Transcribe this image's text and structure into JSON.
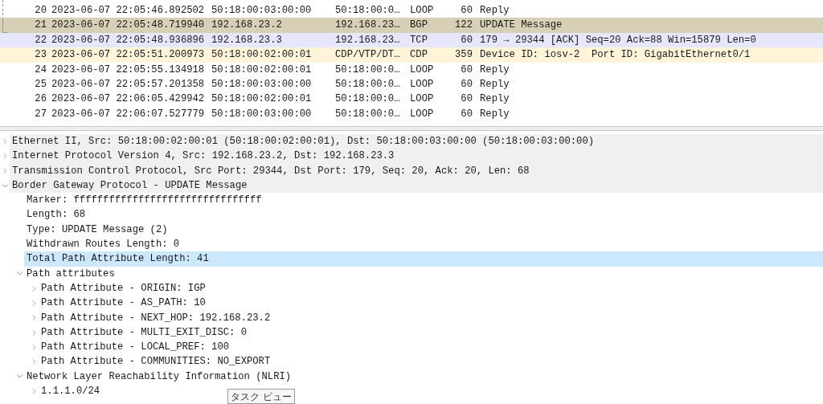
{
  "packet_list": {
    "rows": [
      {
        "cells": [
          "20",
          "2023-06-07 22:05:46.892502",
          "50:18:00:03:00:00",
          "50:18:00:0…",
          "LOOP",
          "60",
          "Reply"
        ],
        "color": "#ffffff"
      },
      {
        "cells": [
          "21",
          "2023-06-07 22:05:48.719940",
          "192.168.23.2",
          "192.168.23…",
          "BGP",
          "122",
          "UPDATE Message"
        ],
        "color": "#d7d0b6"
      },
      {
        "cells": [
          "22",
          "2023-06-07 22:05:48.936896",
          "192.168.23.3",
          "192.168.23…",
          "TCP",
          "60",
          "179 → 29344 [ACK] Seq=20 Ack=88 Win=15879 Len=0"
        ],
        "color": "#e6e6fc"
      },
      {
        "cells": [
          "23",
          "2023-06-07 22:05:51.200973",
          "50:18:00:02:00:01",
          "CDP/VTP/DT…",
          "CDP",
          "359",
          "Device ID: iosv-2  Port ID: GigabitEthernet0/1"
        ],
        "color": "#fff4da"
      },
      {
        "cells": [
          "24",
          "2023-06-07 22:05:55.134918",
          "50:18:00:02:00:01",
          "50:18:00:0…",
          "LOOP",
          "60",
          "Reply"
        ],
        "color": "#ffffff"
      },
      {
        "cells": [
          "25",
          "2023-06-07 22:05:57.201358",
          "50:18:00:03:00:00",
          "50:18:00:0…",
          "LOOP",
          "60",
          "Reply"
        ],
        "color": "#ffffff"
      },
      {
        "cells": [
          "26",
          "2023-06-07 22:06:05.429942",
          "50:18:00:02:00:01",
          "50:18:00:0…",
          "LOOP",
          "60",
          "Reply"
        ],
        "color": "#ffffff"
      },
      {
        "cells": [
          "27",
          "2023-06-07 22:06:07.527779",
          "50:18:00:03:00:00",
          "50:18:00:0…",
          "LOOP",
          "60",
          "Reply"
        ],
        "color": "#ffffff"
      }
    ]
  },
  "packet_details": [
    {
      "label": "Ethernet II, Src: 50:18:00:02:00:01 (50:18:00:02:00:01), Dst: 50:18:00:03:00:00 (50:18:00:03:00:00)",
      "expanded": false,
      "selected": false
    },
    {
      "label": "Internet Protocol Version 4, Src: 192.168.23.2, Dst: 192.168.23.3",
      "expanded": false,
      "selected": false
    },
    {
      "label": "Transmission Control Protocol, Src Port: 29344, Dst Port: 179, Seq: 20, Ack: 20, Len: 68",
      "expanded": false,
      "selected": false
    },
    {
      "label": "Border Gateway Protocol - UPDATE Message",
      "expanded": true,
      "selected": false,
      "children": [
        {
          "label": "Marker: ffffffffffffffffffffffffffffffff",
          "selected": false
        },
        {
          "label": "Length: 68",
          "selected": false
        },
        {
          "label": "Type: UPDATE Message (2)",
          "selected": false
        },
        {
          "label": "Withdrawn Routes Length: 0",
          "selected": false
        },
        {
          "label": "Total Path Attribute Length: 41",
          "selected": true
        },
        {
          "label": "Path attributes",
          "expanded": true,
          "selected": false,
          "children": [
            {
              "label": "Path Attribute - ORIGIN: IGP",
              "expanded": false,
              "selected": false
            },
            {
              "label": "Path Attribute - AS_PATH: 10",
              "expanded": false,
              "selected": false
            },
            {
              "label": "Path Attribute - NEXT_HOP: 192.168.23.2",
              "expanded": false,
              "selected": false
            },
            {
              "label": "Path Attribute - MULTI_EXIT_DISC: 0",
              "expanded": false,
              "selected": false
            },
            {
              "label": "Path Attribute - LOCAL_PREF: 100",
              "expanded": false,
              "selected": false
            },
            {
              "label": "Path Attribute - COMMUNITIES: NO_EXPORT",
              "expanded": false,
              "selected": false
            }
          ]
        },
        {
          "label": "Network Layer Reachability Information (NLRI)",
          "expanded": true,
          "selected": false,
          "children": [
            {
              "label": "1.1.1.0/24",
              "expanded": false,
              "selected": false
            }
          ]
        }
      ]
    }
  ],
  "tooltip": {
    "text": "タスク ビュー"
  }
}
